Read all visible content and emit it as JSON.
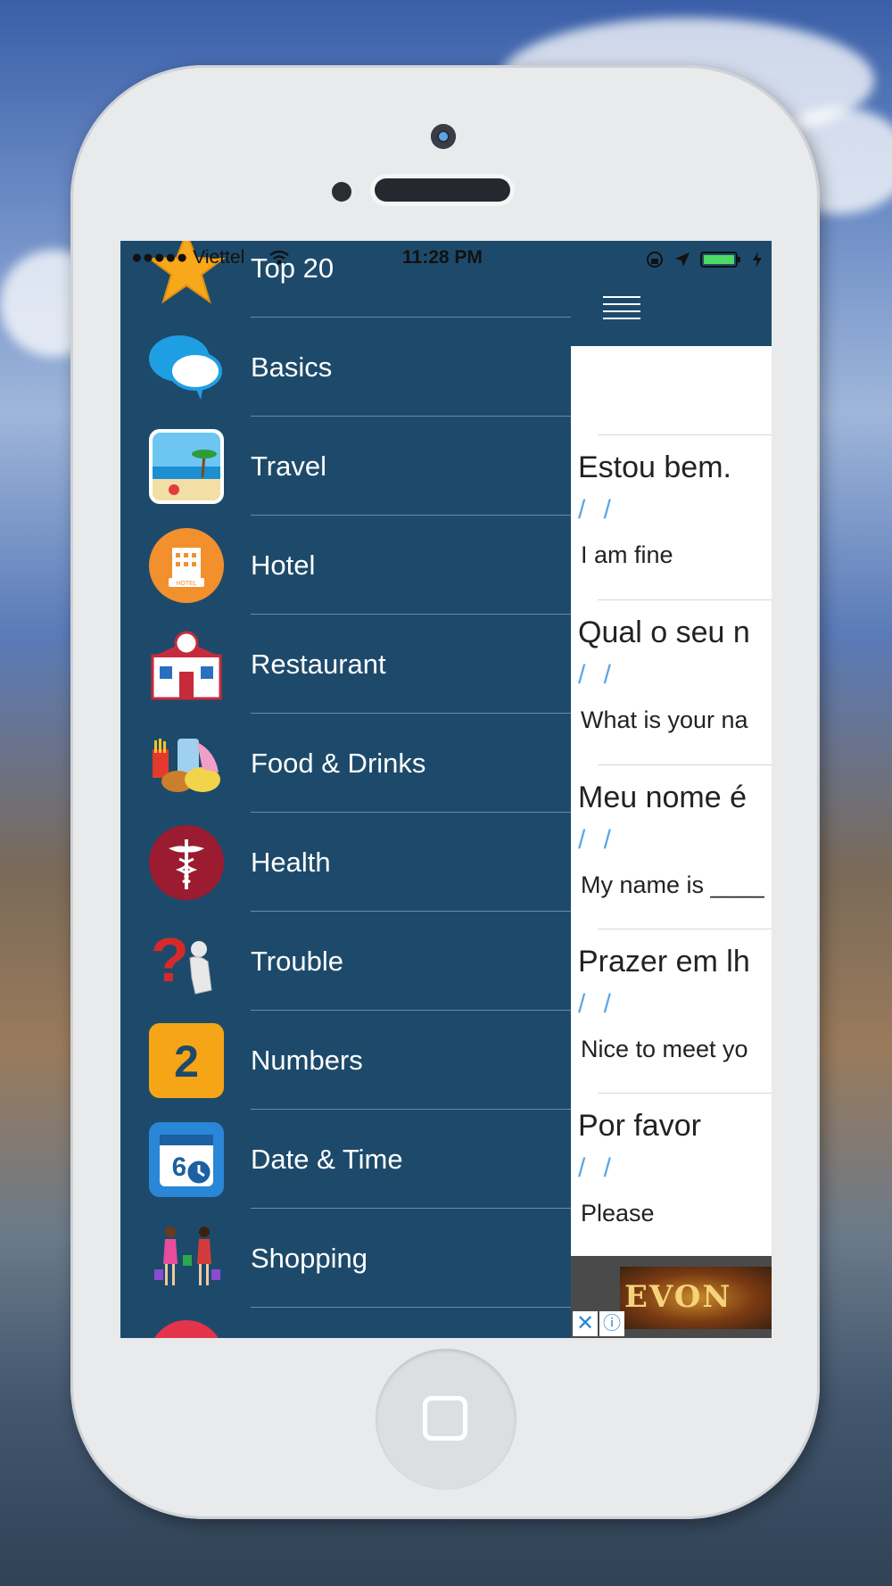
{
  "status_bar": {
    "carrier": "●●●●● Viettel",
    "time": "11:28 PM"
  },
  "menu": {
    "items": [
      {
        "label": "Top 20",
        "icon": "star-icon"
      },
      {
        "label": "Basics",
        "icon": "speech-bubbles-icon"
      },
      {
        "label": "Travel",
        "icon": "beach-icon"
      },
      {
        "label": "Hotel",
        "icon": "hotel-icon"
      },
      {
        "label": "Restaurant",
        "icon": "restaurant-icon"
      },
      {
        "label": "Food & Drinks",
        "icon": "food-drinks-icon"
      },
      {
        "label": "Health",
        "icon": "caduceus-icon"
      },
      {
        "label": "Trouble",
        "icon": "trouble-icon"
      },
      {
        "label": "Numbers",
        "icon": "number-two-icon",
        "icon_text": "2"
      },
      {
        "label": "Date & Time",
        "icon": "calendar-clock-icon",
        "icon_text": "6"
      },
      {
        "label": "Shopping",
        "icon": "shopping-icon"
      }
    ]
  },
  "phrases": [
    {
      "portuguese": "Estou bem.",
      "phonetic": "/ /",
      "english": "I am fine"
    },
    {
      "portuguese": "Qual o seu n",
      "phonetic": "/ /",
      "english": "What is your na"
    },
    {
      "portuguese": "Meu nome é",
      "phonetic": "/ /",
      "english": "My name is ____"
    },
    {
      "portuguese": "Prazer em lh",
      "phonetic": "/ /",
      "english": "Nice to meet yo"
    },
    {
      "portuguese": "Por favor",
      "phonetic": "/ /",
      "english": "Please"
    }
  ],
  "ad": {
    "brand_text": "EVON",
    "close_glyph": "✕",
    "info_glyph": "ⓘ"
  },
  "colors": {
    "menu_bg": "#1d4a6b",
    "accent_blue": "#5aa7e6",
    "phone_body": "#e8eaec"
  }
}
